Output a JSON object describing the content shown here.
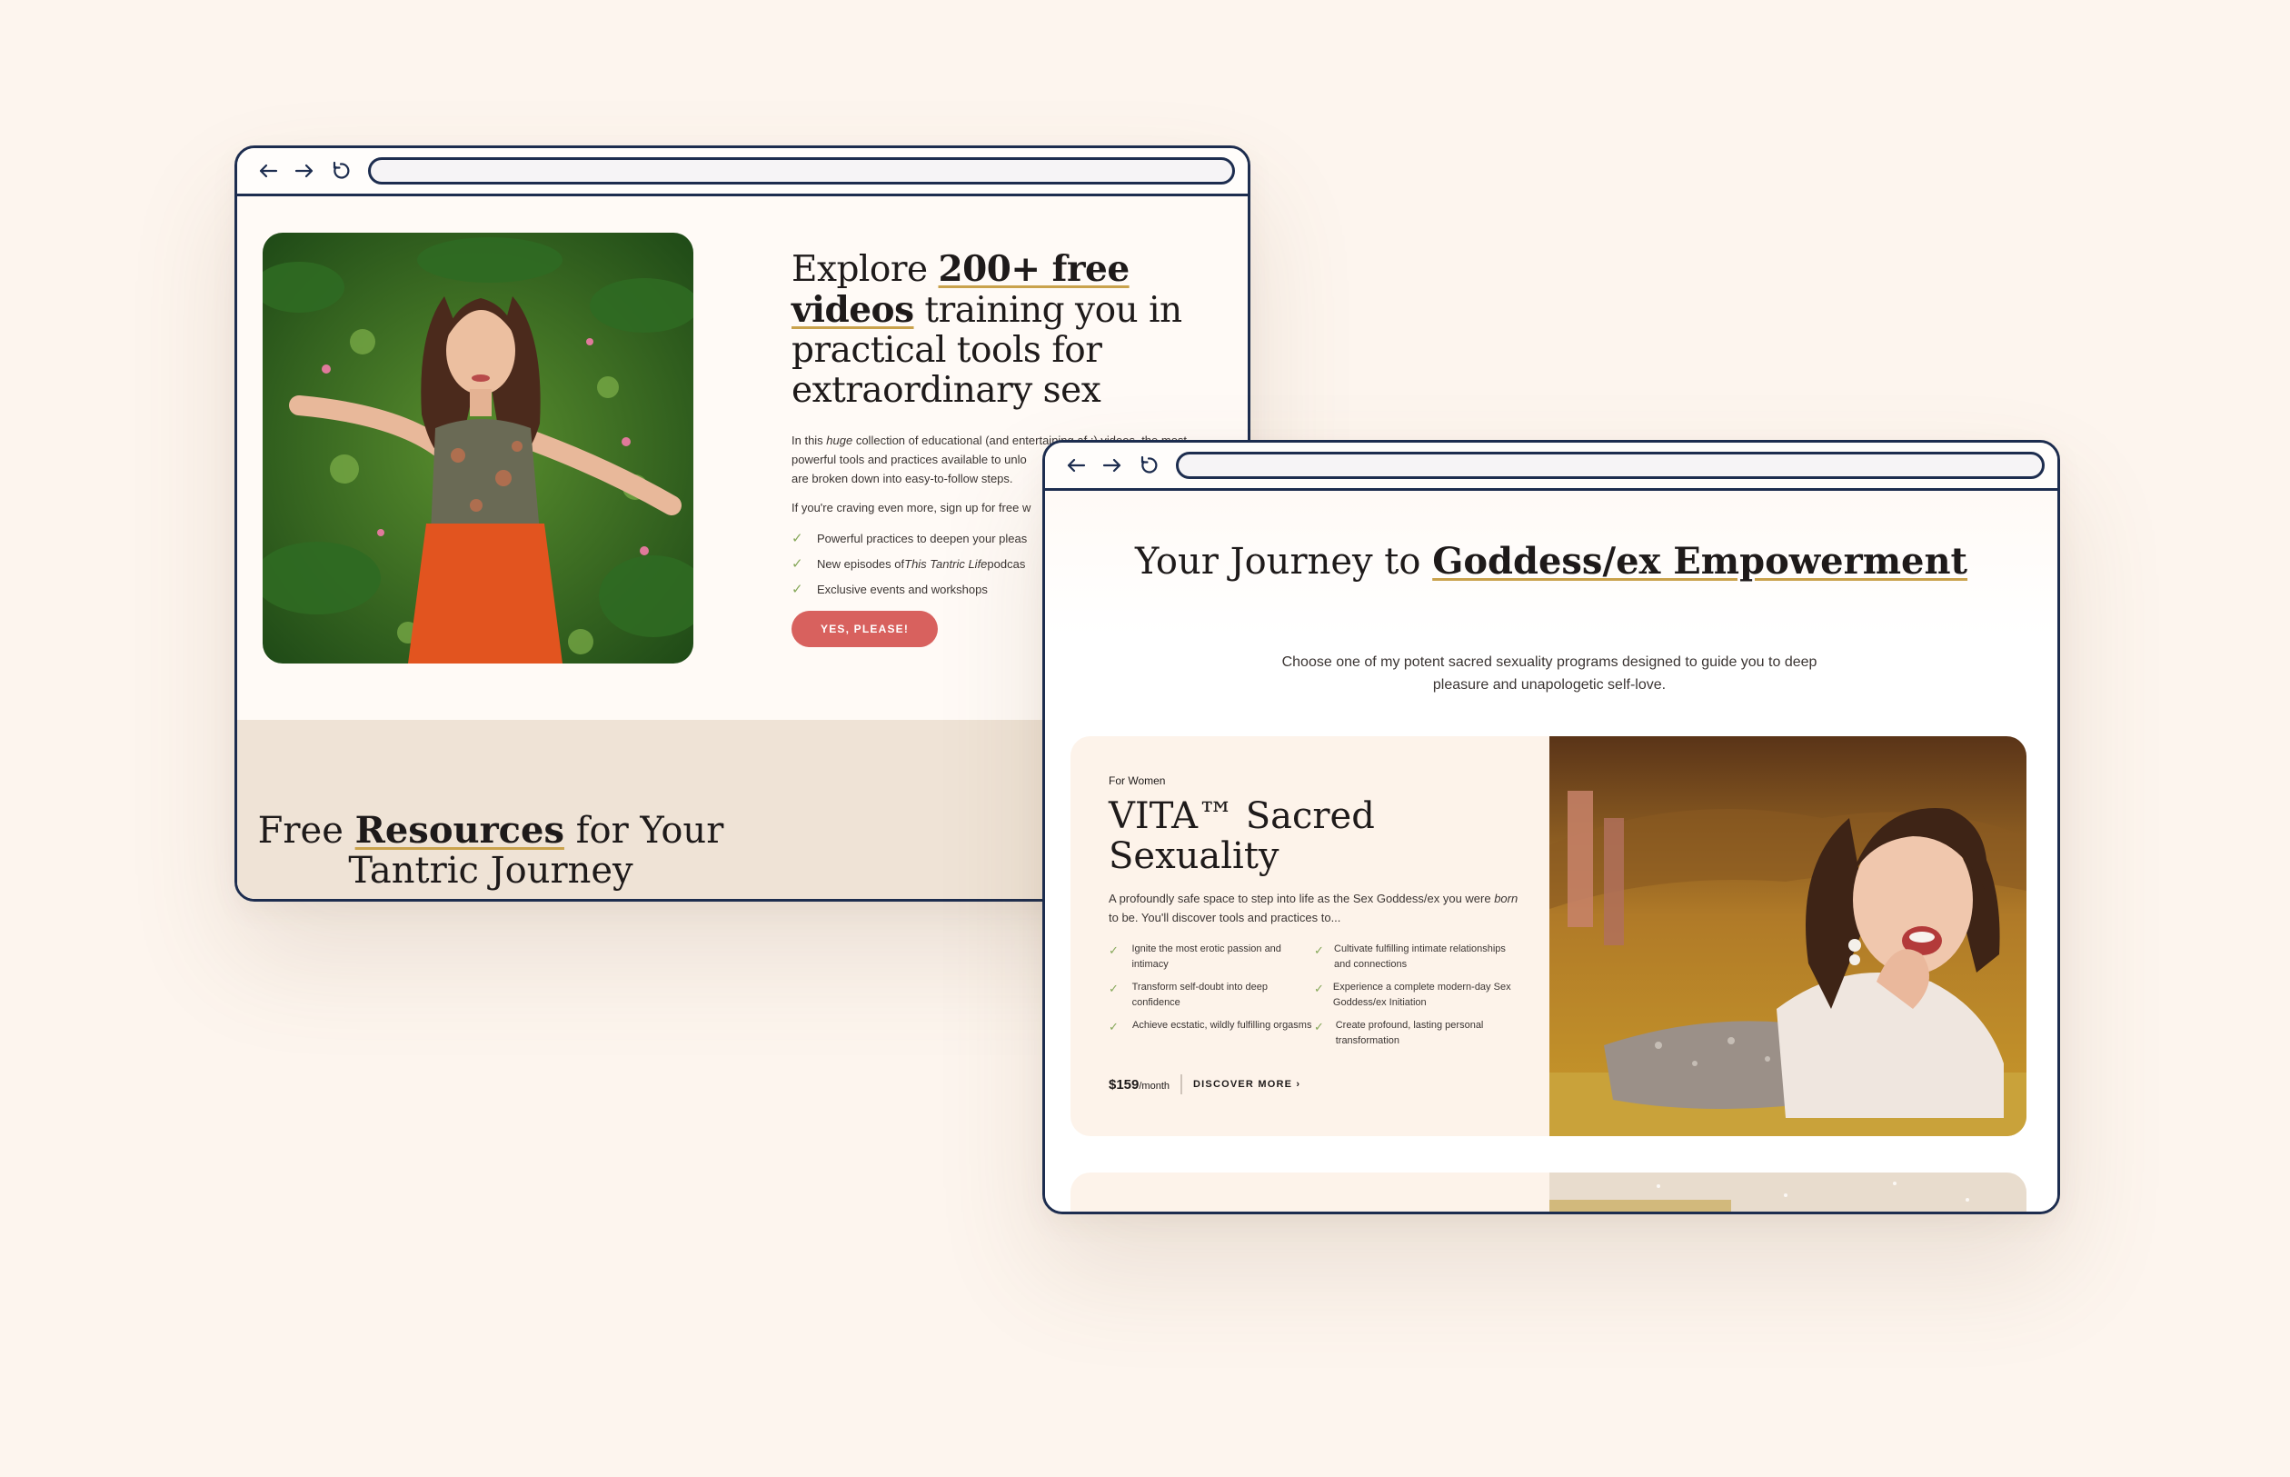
{
  "colors": {
    "page_background": "#fdf5ee",
    "frame_border": "#1d2d4f",
    "accent_gold": "#c9a24c",
    "cta_coral": "#d8615e",
    "check_green": "#86a85a",
    "band_beige": "#efe3d6"
  },
  "browser1": {
    "nav": {
      "back_icon": "arrow-left-icon",
      "forward_icon": "arrow-right-icon",
      "reload_icon": "reload-icon"
    },
    "address_value": "",
    "hero": {
      "heading_pre": "Explore ",
      "heading_highlight": "200+ free videos",
      "heading_post": " training you in practical tools for extraordinary sex",
      "para_part1": "In this ",
      "para_italic": "huge",
      "para_part2": " collection of educational (and entertaining af ;) videos, the most",
      "para_line2": "powerful tools and practices available to unlo",
      "para_line3": "are broken down into easy-to-follow steps.",
      "para2": "If you're craving even more, sign up for free w",
      "checklist": [
        {
          "text": "Powerful practices to deepen your pleas",
          "italic": "",
          "after": ""
        },
        {
          "text": "New episodes of ",
          "italic": "This Tantric Life",
          "after": " podcas"
        },
        {
          "text": "Exclusive events and workshops",
          "italic": "",
          "after": ""
        }
      ],
      "cta": "YES, PLEASE!"
    },
    "resources": {
      "pre": "Free ",
      "highlight": "Resources",
      "post": " for Your Tantric Journey"
    }
  },
  "browser2": {
    "nav": {
      "back_icon": "arrow-left-icon",
      "forward_icon": "arrow-right-icon",
      "reload_icon": "reload-icon"
    },
    "address_value": "",
    "journey": {
      "pre": "Your Journey to ",
      "highlight": "Goddess/ex Empowerment",
      "subtitle": "Choose one of my potent sacred sexuality programs designed to guide you to deep pleasure and unapologetic self-love."
    },
    "card": {
      "eyebrow": "For Women",
      "title": "VITA™ Sacred Sexuality",
      "desc_part1": "A profoundly safe space to step into life as the Sex Goddess/ex you were ",
      "desc_italic": "born",
      "desc_part2": " to be. You'll discover tools and practices to...",
      "benefits": [
        "Ignite the most erotic passion and intimacy",
        "Cultivate fulfilling intimate relationships and connections",
        "Transform self-doubt into deep confidence",
        "Experience a complete modern-day Sex Goddess/ex Initiation",
        "Achieve ecstatic, wildly fulfilling orgasms",
        "Create profound, lasting personal transformation"
      ],
      "price": "$159",
      "price_unit": "/month",
      "discover": "DISCOVER MORE",
      "discover_icon": "chevron-right-icon"
    }
  }
}
